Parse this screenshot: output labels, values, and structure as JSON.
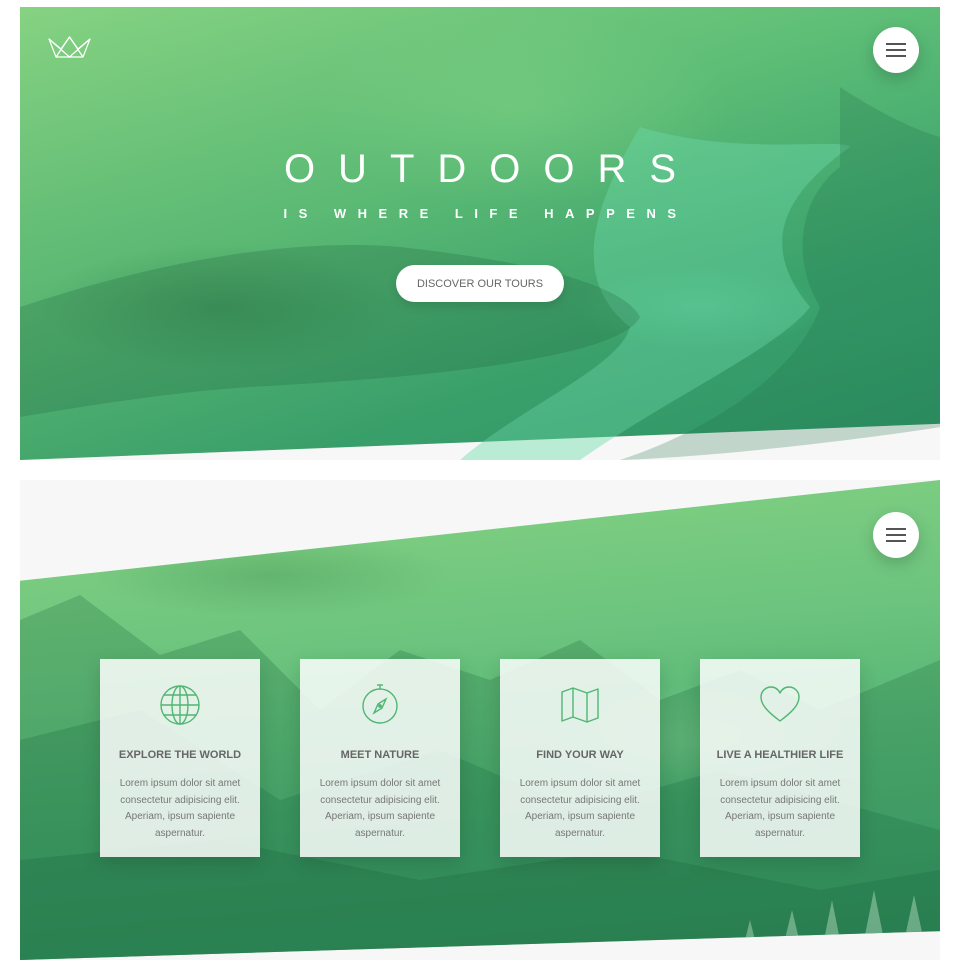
{
  "hero": {
    "title": "OUTDOORS",
    "subtitle": "IS WHERE LIFE HAPPENS",
    "cta_label": "DISCOVER OUR TOURS",
    "logo_icon": "crown-icon",
    "menu_icon": "hamburger-menu-icon"
  },
  "features": {
    "menu_icon": "hamburger-menu-icon",
    "cards": [
      {
        "icon": "globe-icon",
        "title": "EXPLORE THE WORLD",
        "text": "Lorem ipsum dolor sit amet consectetur adipisicing elit. Aperiam, ipsum sapiente aspernatur."
      },
      {
        "icon": "compass-icon",
        "title": "MEET NATURE",
        "text": "Lorem ipsum dolor sit amet consectetur adipisicing elit. Aperiam, ipsum sapiente aspernatur."
      },
      {
        "icon": "map-icon",
        "title": "FIND YOUR WAY",
        "text": "Lorem ipsum dolor sit amet consectetur adipisicing elit. Aperiam, ipsum sapiente aspernatur."
      },
      {
        "icon": "heart-icon",
        "title": "LIVE A HEALTHIER LIFE",
        "text": "Lorem ipsum dolor sit amet consectetur adipisicing elit. Aperiam, ipsum sapiente aspernatur."
      }
    ]
  },
  "colors": {
    "gradient_light": "#86d282",
    "gradient_dark": "#2f9a6c",
    "icon_stroke": "#4fb673",
    "page_background": "#f7f7f7"
  }
}
